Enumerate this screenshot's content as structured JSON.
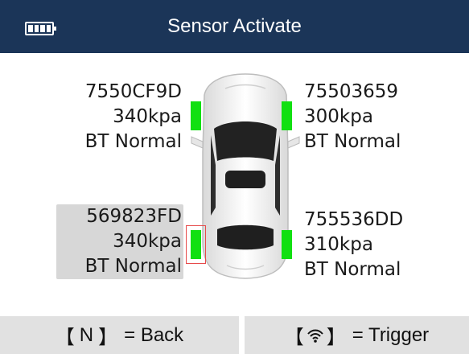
{
  "header": {
    "title": "Sensor Activate",
    "battery_icon": "battery-full-icon"
  },
  "sensors": {
    "front_left": {
      "id": "7550CF9D",
      "pressure": "340kpa",
      "status": "BT Normal"
    },
    "front_right": {
      "id": "75503659",
      "pressure": "300kpa",
      "status": "BT Normal"
    },
    "rear_left": {
      "id": "569823FD",
      "pressure": "340kpa",
      "status": "BT Normal",
      "selected": true
    },
    "rear_right": {
      "id": "755536DD",
      "pressure": "310kpa",
      "status": "BT Normal"
    }
  },
  "footer": {
    "back": {
      "open": "【",
      "key": "N",
      "close": "】",
      "label": "= Back"
    },
    "trigger": {
      "open": "【",
      "icon": "wifi-icon",
      "close": "】",
      "label": "= Trigger"
    }
  },
  "colors": {
    "header_bg": "#1b3558",
    "sensor_ok": "#11e011",
    "selection_outline": "#e74b4b",
    "selection_bg": "#d7d7d7",
    "footer_bg": "#e1e1e1"
  }
}
